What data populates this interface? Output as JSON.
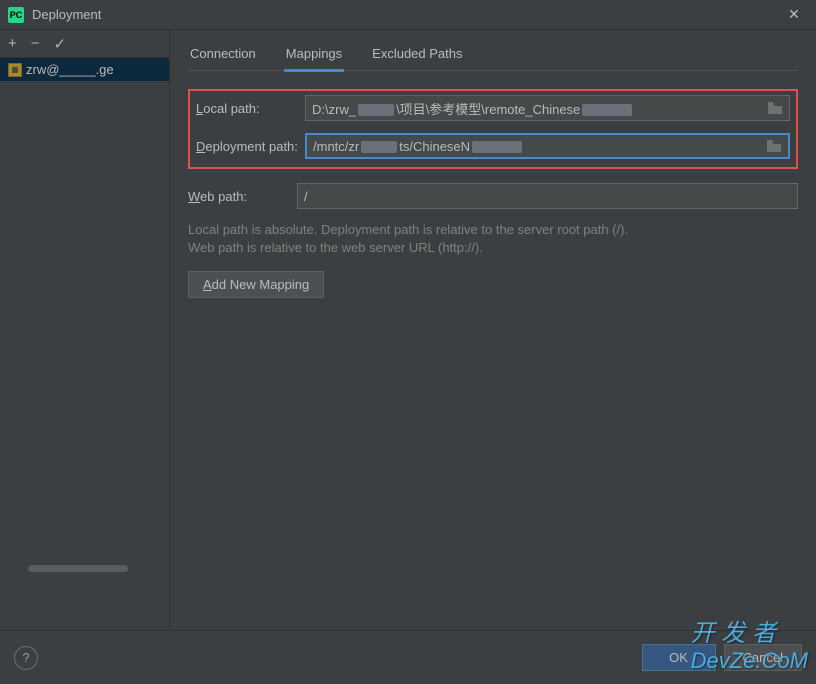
{
  "title": "Deployment",
  "sidebar": {
    "server_label": "zrw@_____.ge"
  },
  "tabs": {
    "connection": "Connection",
    "mappings": "Mappings",
    "excluded": "Excluded Paths"
  },
  "form": {
    "local_label_pre": "L",
    "local_label_post": "ocal path:",
    "local_value_1": "D:\\zrw_",
    "local_value_2": "\\项目\\参考模型\\remote_Chinese",
    "deploy_label_pre": "D",
    "deploy_label_post": "eployment path:",
    "deploy_value_1": "/mntc/zr",
    "deploy_value_2": "ts/ChineseN",
    "web_label_pre": "W",
    "web_label_post": "eb path:",
    "web_value": "/"
  },
  "info": {
    "line1": "Local path is absolute. Deployment path is relative to the server root path (/).",
    "line2": "Web path is relative to the web server URL (http://)."
  },
  "buttons": {
    "add_pre": "A",
    "add_post": "dd New Mapping",
    "ok": "OK",
    "cancel": "Cancel"
  },
  "watermark": {
    "cn": "开 发 者",
    "en": "DevZe.CoM"
  }
}
